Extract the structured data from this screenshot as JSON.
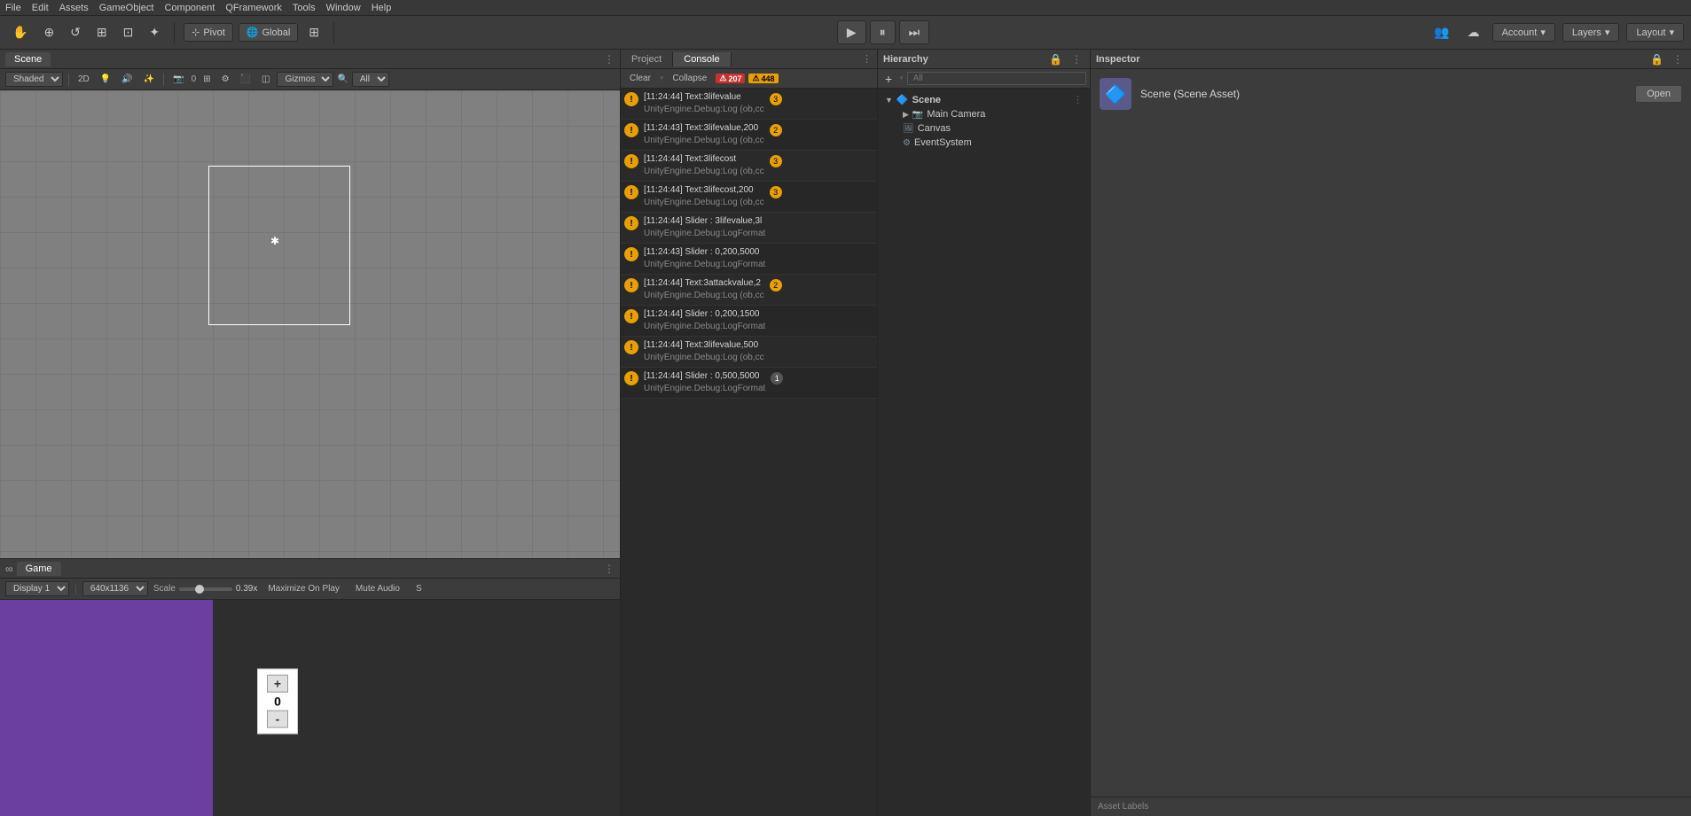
{
  "menu": {
    "items": [
      "File",
      "Edit",
      "Assets",
      "GameObject",
      "Component",
      "QFramework",
      "Tools",
      "Window",
      "Help"
    ]
  },
  "toolbar": {
    "hand_tool": "✋",
    "move_tool": "⊕",
    "rotate_tool": "↺",
    "scale_tool": "⊞",
    "rect_tool": "⊡",
    "transform_tool": "✦",
    "pivot_label": "Pivot",
    "global_label": "Global",
    "grid_btn": "⊞",
    "play_btn": "▶",
    "pause_btn": "⏸",
    "step_btn": "⏭",
    "collab_icon": "👥",
    "cloud_icon": "☁",
    "account_label": "Account",
    "layers_label": "Layers",
    "layout_label": "Layout"
  },
  "scene": {
    "tab_label": "Scene",
    "shaded_label": "Shaded",
    "two_d_label": "2D",
    "gizmos_label": "Gizmos",
    "all_label": "All"
  },
  "game": {
    "tab_label": "Game",
    "display_label": "Display 1",
    "resolution_label": "640x1136",
    "scale_label": "Scale",
    "scale_value": "0.39x",
    "maximize_label": "Maximize On Play",
    "mute_label": "Mute Audio",
    "counter_plus": "+",
    "counter_zero": "0",
    "counter_minus": "-"
  },
  "console": {
    "project_tab": "Project",
    "console_tab": "Console",
    "clear_btn": "Clear",
    "collapse_btn": "Collapse",
    "error_count": "207",
    "warning_count": "448",
    "entries": [
      {
        "time": "[11:24:44]",
        "text1": "Text:3lifevalue",
        "text2": "UnityEngine.Debug:Log (ob,cc",
        "count": "3",
        "count_type": "warn"
      },
      {
        "time": "[11:24:43]",
        "text1": "Text:3lifevalue,200",
        "text2": "UnityEngine.Debug:Log (ob,cc",
        "count": "2",
        "count_type": "warn"
      },
      {
        "time": "[11:24:44]",
        "text1": "Text:3lifecost",
        "text2": "UnityEngine.Debug:Log (ob,cc",
        "count": "3",
        "count_type": "warn"
      },
      {
        "time": "[11:24:44]",
        "text1": "Text:3lifecost,200",
        "text2": "UnityEngine.Debug:Log (ob,cc",
        "count": "3",
        "count_type": "warn"
      },
      {
        "time": "[11:24:44]",
        "text1": "Slider : 3lifevalue,3l",
        "text2": "UnityEngine.Debug:LogFormat",
        "count": "",
        "count_type": ""
      },
      {
        "time": "[11:24:43]",
        "text1": "Slider : 0,200,5000",
        "text2": "UnityEngine.Debug:LogFormat",
        "count": "",
        "count_type": ""
      },
      {
        "time": "[11:24:44]",
        "text1": "Text:3attackvalue,2",
        "text2": "UnityEngine.Debug:Log (ob,cc",
        "count": "2",
        "count_type": "warn"
      },
      {
        "time": "[11:24:44]",
        "text1": "Slider : 0,200,1500",
        "text2": "UnityEngine.Debug:LogFormat",
        "count": "",
        "count_type": ""
      },
      {
        "time": "[11:24:44]",
        "text1": "Text:3lifevalue,500",
        "text2": "UnityEngine.Debug:Log (ob,cc",
        "count": "",
        "count_type": ""
      },
      {
        "time": "[11:24:44]",
        "text1": "Slider : 0,500,5000",
        "text2": "UnityEngine.Debug:LogFormat",
        "count": "1",
        "count_type": ""
      }
    ]
  },
  "hierarchy": {
    "label": "Hierarchy",
    "search_placeholder": "All",
    "scene_name": "Scene",
    "items": [
      {
        "label": "Main Camera",
        "icon": "📷"
      },
      {
        "label": "Canvas",
        "icon": "🖼"
      },
      {
        "label": "EventSystem",
        "icon": "⚙"
      }
    ]
  },
  "inspector": {
    "label": "Inspector",
    "scene_asset_label": "Scene (Scene Asset)",
    "open_btn": "Open",
    "asset_labels": "Asset Labels"
  }
}
